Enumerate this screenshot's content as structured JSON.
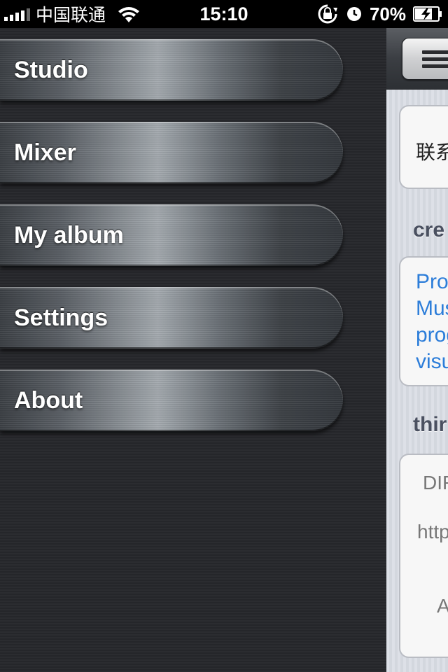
{
  "status_bar": {
    "carrier": "中国联通",
    "time": "15:10",
    "battery_percent": "70%",
    "signal_bars": 4,
    "icons": [
      "signal-icon",
      "wifi-icon",
      "rotation-lock-icon",
      "alarm-icon",
      "battery-charging-icon"
    ]
  },
  "menu": {
    "items": [
      {
        "label": "Studio"
      },
      {
        "label": "Mixer"
      },
      {
        "label": "My album"
      },
      {
        "label": "Settings"
      },
      {
        "label": "About"
      }
    ]
  },
  "content": {
    "navbar_button_icon": "hamburger-menu-icon",
    "contact_partial": "联系",
    "credits_header_partial": "cre",
    "credits_lines_partial": [
      "Proc",
      "Mus",
      "prog",
      "visu"
    ],
    "third_header_partial": "thir",
    "third_lines_partial": [
      "DIR",
      "http",
      "A"
    ]
  },
  "colors": {
    "link": "#2c7dd9",
    "menu_background": "#2b2c30",
    "content_background": "#dde0e7"
  }
}
